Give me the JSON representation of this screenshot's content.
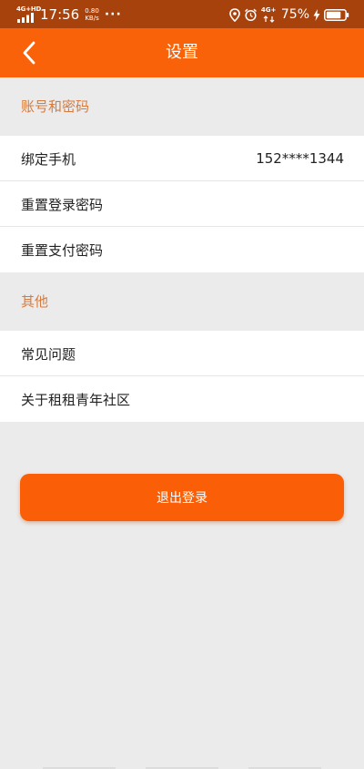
{
  "status_bar": {
    "network": "4G",
    "network_sup": "+HD",
    "time": "17:56",
    "speed_value": "0.80",
    "speed_unit": "KB/s",
    "dots": "···",
    "network2": "4G",
    "network2_sup": "+",
    "battery_text": "75%"
  },
  "app_bar": {
    "title": "设置"
  },
  "sections": {
    "account": {
      "title": "账号和密码",
      "items": [
        {
          "label": "绑定手机",
          "value": "152****1344"
        },
        {
          "label": "重置登录密码"
        },
        {
          "label": "重置支付密码"
        }
      ]
    },
    "other": {
      "title": "其他",
      "items": [
        {
          "label": "常见问题"
        },
        {
          "label": "关于租租青年社区"
        }
      ]
    }
  },
  "logout": {
    "label": "退出登录"
  },
  "colors": {
    "status_bar": "#a8420d",
    "accent": "#fa6209",
    "section_text": "#d97a3c",
    "background": "#ebebeb"
  }
}
